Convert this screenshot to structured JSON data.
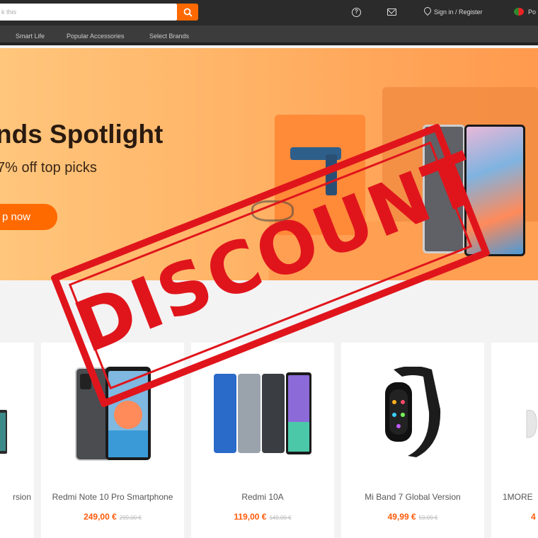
{
  "header": {
    "search_placeholder": "k this",
    "signin_label": "Sign in / Register",
    "region_label": "Po"
  },
  "nav": {
    "items": [
      {
        "label": "Smart Life"
      },
      {
        "label": "Popular Accessories"
      },
      {
        "label": "Select Brands"
      }
    ]
  },
  "banner": {
    "title": "nds Spotlight",
    "subtitle": "7% off top picks",
    "button_label": "p now"
  },
  "products": [
    {
      "name": "rsion",
      "price": "",
      "old_price": ""
    },
    {
      "name": "Redmi Note 10 Pro Smartphone",
      "price": "249,00 €",
      "old_price": "299,00 €"
    },
    {
      "name": "Redmi 10A",
      "price": "119,00 €",
      "old_price": "149,00 €"
    },
    {
      "name": "Mi Band 7 Global Version",
      "price": "49,99 €",
      "old_price": "59,99 €"
    },
    {
      "name": "1MORE",
      "price": "4",
      "old_price": ""
    }
  ],
  "stamp": {
    "text": "DISCOUNT",
    "color": "#e0151c"
  },
  "colors": {
    "accent": "#ff6900",
    "topbar": "#2b2b2b",
    "nav": "#3c3c3c"
  }
}
